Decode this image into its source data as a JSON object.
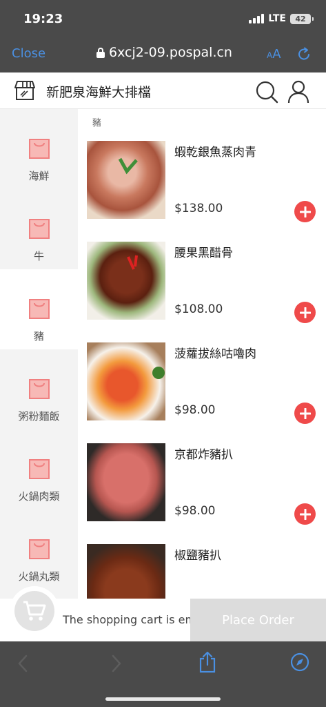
{
  "status": {
    "time": "19:23",
    "network": "LTE",
    "battery": "42"
  },
  "browser": {
    "close_label": "Close",
    "url": "6xcj2-09.pospal.cn",
    "text_size_label_small": "A",
    "text_size_label_large": "A"
  },
  "header": {
    "title": "新肥泉海鮮大排檔"
  },
  "sidebar": {
    "items": [
      {
        "label": "海鮮"
      },
      {
        "label": "牛"
      },
      {
        "label": "豬"
      },
      {
        "label": "粥粉麵飯"
      },
      {
        "label": "火鍋肉類"
      },
      {
        "label": "火鍋丸類"
      }
    ],
    "active_index": 2
  },
  "content": {
    "section": "豬",
    "products": [
      {
        "name": "蝦乾銀魚蒸肉青",
        "price": "$138.00"
      },
      {
        "name": "腰果黑醋骨",
        "price": "$108.00"
      },
      {
        "name": "菠蘿拔絲咕嚕肉",
        "price": "$98.00"
      },
      {
        "name": "京都炸豬扒",
        "price": "$98.00"
      },
      {
        "name": "椒鹽豬扒",
        "price": ""
      }
    ]
  },
  "cart": {
    "status": "The shopping cart is empty",
    "place_order_label": "Place Order"
  },
  "colors": {
    "accent": "#4a90e2",
    "add_button": "#ef4a4a",
    "bag_icon": "#f49a9a",
    "chrome": "#4a4a4a"
  }
}
